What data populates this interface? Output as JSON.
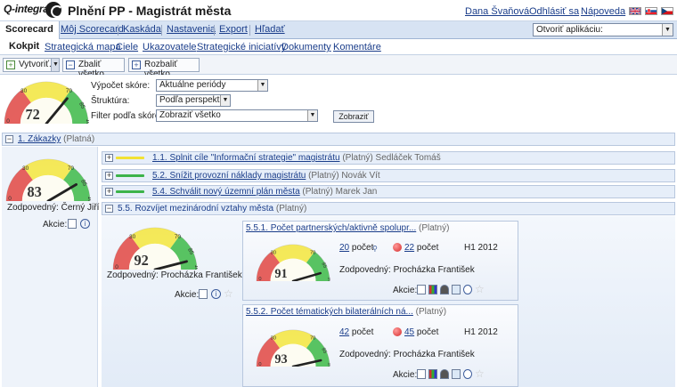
{
  "header": {
    "logo": "Q-integra",
    "title": "Plnění PP - Magistrát města",
    "user": "Dana Švaňová",
    "logout": "Odhlásiť sa",
    "help": "Nápoveda"
  },
  "main_nav": {
    "active": "Scorecard",
    "items": [
      "Môj Scorecard",
      "Kaskáda",
      "Nastavenia",
      "Export",
      "Hľadať"
    ],
    "app_select": "Otvoriť aplikáciu:"
  },
  "sub_nav": {
    "active": "Kokpit",
    "items": [
      "Strategická mapa",
      "Ciele",
      "Ukazovatele",
      "Strategické iniciatívy",
      "Dokumenty",
      "Komentáre"
    ]
  },
  "toolbar": {
    "create": "Vytvoriť...",
    "collapse": "Zbaliť všetko",
    "expand": "Rozbaliť všetko"
  },
  "filters": {
    "score_calc_label": "Výpočet skóre:",
    "score_calc_value": "Aktuálne periódy",
    "structure_label": "Štruktúra:",
    "structure_value": "Podľa perspektív",
    "filter_label": "Filter podľa skóre:",
    "filter_value": "Zobraziť všetko",
    "show_button": "Zobraziť"
  },
  "gauge_ticks": {
    "t0": "0",
    "t30": "30",
    "t70": "70",
    "t85": "85",
    "t100": "100"
  },
  "top_gauge": {
    "value": 72
  },
  "perspective": {
    "title": "1. Zákazky",
    "status": "(Platná)",
    "gauge": {
      "value": 83
    },
    "owner": "Zodpovedný: Černý Jiří",
    "actions": "Akcie:"
  },
  "objectives": [
    {
      "title": "1.1. Splnit cíle \"Informační strategie\" magistrátu",
      "status": "(Platný)",
      "owner": "Sedláček Tomáš",
      "color": "#f2e233"
    },
    {
      "title": "5.2. Snížit provozní náklady magistrátu",
      "status": "(Platný)",
      "owner": "Novák Vít",
      "color": "#3cb34a"
    },
    {
      "title": "5.4. Schválit nový územní plán města",
      "status": "(Platný)",
      "owner": "Marek Jan",
      "color": "#3cb34a"
    }
  ],
  "expanded_objective": {
    "title": "5.5. Rozvíjet mezinárodní vztahy města",
    "status": "(Platný)",
    "gauge": {
      "value": 92
    },
    "owner": "Zodpovedný: Procházka František",
    "actions": "Akcie:"
  },
  "kpis": [
    {
      "title": "5.5.1. Počet partnerských/aktivně spolupr...",
      "status": "(Platný)",
      "actual": "20",
      "target": "22",
      "unit": "počet",
      "period": "H1 2012",
      "owner": "Zodpovedný: Procházka František",
      "actions": "Akcie:",
      "gauge": {
        "value": 91
      }
    },
    {
      "title": "5.5.2. Počet tématických bilaterálních ná...",
      "status": "(Platný)",
      "actual": "42",
      "target": "45",
      "unit": "počet",
      "period": "H1 2012",
      "owner": "Zodpovedný: Procházka František",
      "actions": "Akcie:",
      "gauge": {
        "value": 93
      }
    }
  ]
}
